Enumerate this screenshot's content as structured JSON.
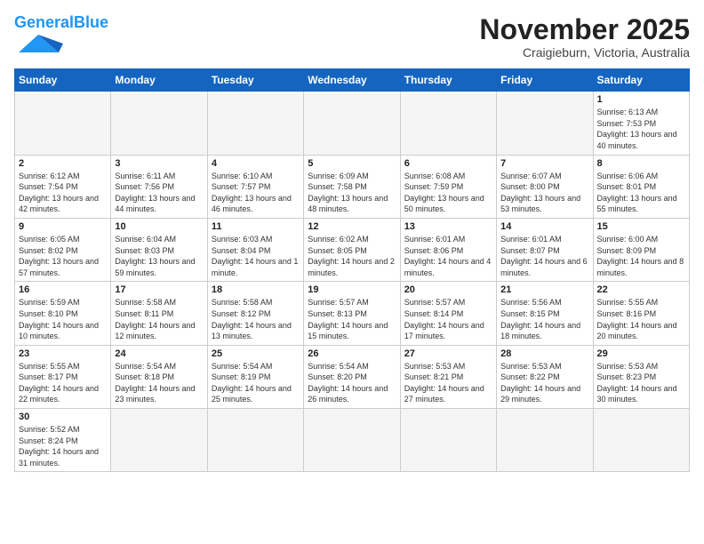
{
  "header": {
    "logo_general": "General",
    "logo_blue": "Blue",
    "month_title": "November 2025",
    "location": "Craigieburn, Victoria, Australia"
  },
  "days_of_week": [
    "Sunday",
    "Monday",
    "Tuesday",
    "Wednesday",
    "Thursday",
    "Friday",
    "Saturday"
  ],
  "weeks": [
    [
      {
        "day": "",
        "info": ""
      },
      {
        "day": "",
        "info": ""
      },
      {
        "day": "",
        "info": ""
      },
      {
        "day": "",
        "info": ""
      },
      {
        "day": "",
        "info": ""
      },
      {
        "day": "",
        "info": ""
      },
      {
        "day": "1",
        "info": "Sunrise: 6:13 AM\nSunset: 7:53 PM\nDaylight: 13 hours and 40 minutes."
      }
    ],
    [
      {
        "day": "2",
        "info": "Sunrise: 6:12 AM\nSunset: 7:54 PM\nDaylight: 13 hours and 42 minutes."
      },
      {
        "day": "3",
        "info": "Sunrise: 6:11 AM\nSunset: 7:56 PM\nDaylight: 13 hours and 44 minutes."
      },
      {
        "day": "4",
        "info": "Sunrise: 6:10 AM\nSunset: 7:57 PM\nDaylight: 13 hours and 46 minutes."
      },
      {
        "day": "5",
        "info": "Sunrise: 6:09 AM\nSunset: 7:58 PM\nDaylight: 13 hours and 48 minutes."
      },
      {
        "day": "6",
        "info": "Sunrise: 6:08 AM\nSunset: 7:59 PM\nDaylight: 13 hours and 50 minutes."
      },
      {
        "day": "7",
        "info": "Sunrise: 6:07 AM\nSunset: 8:00 PM\nDaylight: 13 hours and 53 minutes."
      },
      {
        "day": "8",
        "info": "Sunrise: 6:06 AM\nSunset: 8:01 PM\nDaylight: 13 hours and 55 minutes."
      }
    ],
    [
      {
        "day": "9",
        "info": "Sunrise: 6:05 AM\nSunset: 8:02 PM\nDaylight: 13 hours and 57 minutes."
      },
      {
        "day": "10",
        "info": "Sunrise: 6:04 AM\nSunset: 8:03 PM\nDaylight: 13 hours and 59 minutes."
      },
      {
        "day": "11",
        "info": "Sunrise: 6:03 AM\nSunset: 8:04 PM\nDaylight: 14 hours and 1 minute."
      },
      {
        "day": "12",
        "info": "Sunrise: 6:02 AM\nSunset: 8:05 PM\nDaylight: 14 hours and 2 minutes."
      },
      {
        "day": "13",
        "info": "Sunrise: 6:01 AM\nSunset: 8:06 PM\nDaylight: 14 hours and 4 minutes."
      },
      {
        "day": "14",
        "info": "Sunrise: 6:01 AM\nSunset: 8:07 PM\nDaylight: 14 hours and 6 minutes."
      },
      {
        "day": "15",
        "info": "Sunrise: 6:00 AM\nSunset: 8:09 PM\nDaylight: 14 hours and 8 minutes."
      }
    ],
    [
      {
        "day": "16",
        "info": "Sunrise: 5:59 AM\nSunset: 8:10 PM\nDaylight: 14 hours and 10 minutes."
      },
      {
        "day": "17",
        "info": "Sunrise: 5:58 AM\nSunset: 8:11 PM\nDaylight: 14 hours and 12 minutes."
      },
      {
        "day": "18",
        "info": "Sunrise: 5:58 AM\nSunset: 8:12 PM\nDaylight: 14 hours and 13 minutes."
      },
      {
        "day": "19",
        "info": "Sunrise: 5:57 AM\nSunset: 8:13 PM\nDaylight: 14 hours and 15 minutes."
      },
      {
        "day": "20",
        "info": "Sunrise: 5:57 AM\nSunset: 8:14 PM\nDaylight: 14 hours and 17 minutes."
      },
      {
        "day": "21",
        "info": "Sunrise: 5:56 AM\nSunset: 8:15 PM\nDaylight: 14 hours and 18 minutes."
      },
      {
        "day": "22",
        "info": "Sunrise: 5:55 AM\nSunset: 8:16 PM\nDaylight: 14 hours and 20 minutes."
      }
    ],
    [
      {
        "day": "23",
        "info": "Sunrise: 5:55 AM\nSunset: 8:17 PM\nDaylight: 14 hours and 22 minutes."
      },
      {
        "day": "24",
        "info": "Sunrise: 5:54 AM\nSunset: 8:18 PM\nDaylight: 14 hours and 23 minutes."
      },
      {
        "day": "25",
        "info": "Sunrise: 5:54 AM\nSunset: 8:19 PM\nDaylight: 14 hours and 25 minutes."
      },
      {
        "day": "26",
        "info": "Sunrise: 5:54 AM\nSunset: 8:20 PM\nDaylight: 14 hours and 26 minutes."
      },
      {
        "day": "27",
        "info": "Sunrise: 5:53 AM\nSunset: 8:21 PM\nDaylight: 14 hours and 27 minutes."
      },
      {
        "day": "28",
        "info": "Sunrise: 5:53 AM\nSunset: 8:22 PM\nDaylight: 14 hours and 29 minutes."
      },
      {
        "day": "29",
        "info": "Sunrise: 5:53 AM\nSunset: 8:23 PM\nDaylight: 14 hours and 30 minutes."
      }
    ],
    [
      {
        "day": "30",
        "info": "Sunrise: 5:52 AM\nSunset: 8:24 PM\nDaylight: 14 hours and 31 minutes."
      },
      {
        "day": "",
        "info": ""
      },
      {
        "day": "",
        "info": ""
      },
      {
        "day": "",
        "info": ""
      },
      {
        "day": "",
        "info": ""
      },
      {
        "day": "",
        "info": ""
      },
      {
        "day": "",
        "info": ""
      }
    ]
  ]
}
